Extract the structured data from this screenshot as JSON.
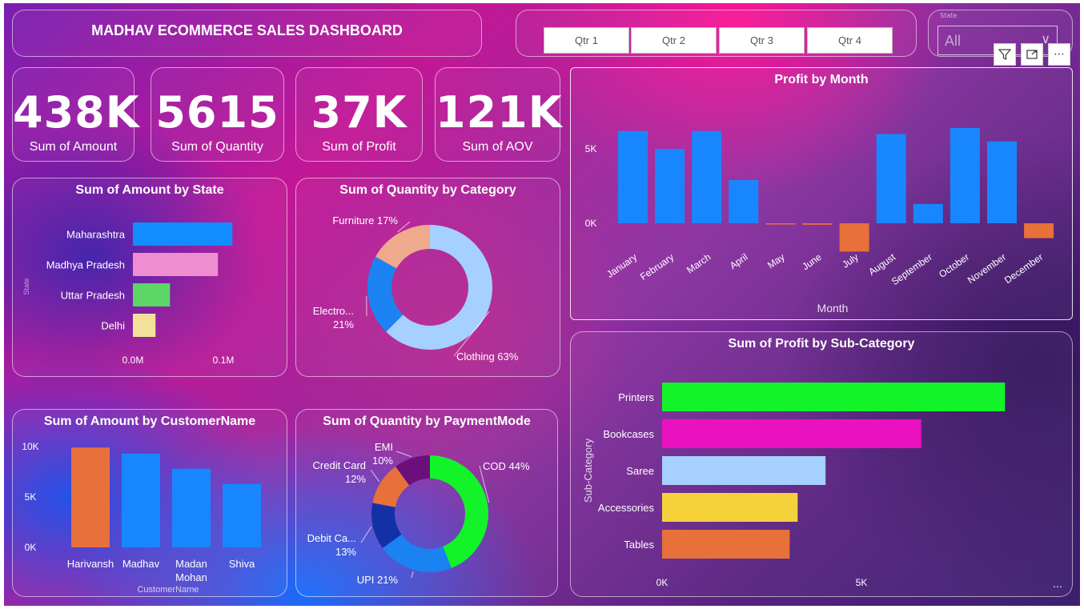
{
  "header": {
    "title": "MADHAV ECOMMERCE SALES DASHBOARD"
  },
  "quarters": [
    "Qtr 1",
    "Qtr 2",
    "Qtr 3",
    "Qtr 4"
  ],
  "state_slicer": {
    "label": "State",
    "value": "All"
  },
  "kpis": [
    {
      "value": "438K",
      "label": "Sum of Amount"
    },
    {
      "value": "5615",
      "label": "Sum of Quantity"
    },
    {
      "value": "37K",
      "label": "Sum of Profit"
    },
    {
      "value": "121K",
      "label": "Sum of AOV"
    }
  ],
  "chart_data": [
    {
      "id": "amount_by_state",
      "type": "bar",
      "orientation": "horizontal",
      "title": "Sum of Amount by State",
      "ylabel": "State",
      "categories": [
        "Maharashtra",
        "Madhya Pradesh",
        "Uttar Pradesh",
        "Delhi"
      ],
      "values": [
        0.11,
        0.094,
        0.041,
        0.025
      ],
      "colors": [
        "#118DFF",
        "#EE8DD0",
        "#5BD667",
        "#F3E19A"
      ],
      "xticks": [
        "0.0M",
        "0.1M"
      ],
      "xlim": [
        0,
        0.1
      ]
    },
    {
      "id": "quantity_by_category",
      "type": "pie",
      "donut": true,
      "title": "Sum of Quantity by Category",
      "labels": [
        "Clothing 63%",
        "Electro...\n21%",
        "Furniture 17%"
      ],
      "values": [
        63,
        21,
        17
      ],
      "colors": [
        "#A5D0FF",
        "#1B84F2",
        "#EFA98C"
      ]
    },
    {
      "id": "amount_by_customer",
      "type": "bar",
      "title": "Sum of Amount by CustomerName",
      "xlabel": "CustomerName",
      "categories": [
        "Harivansh",
        "Madhav",
        "Madan Mohan",
        "Shiva"
      ],
      "values": [
        9900,
        9300,
        7800,
        6300
      ],
      "colors": [
        "#E8703A",
        "#1887FF",
        "#1887FF",
        "#1887FF"
      ],
      "yticks": [
        "0K",
        "5K",
        "10K"
      ],
      "ylim": [
        0,
        10000
      ]
    },
    {
      "id": "quantity_by_payment",
      "type": "pie",
      "donut": true,
      "title": "Sum of Quantity by PaymentMode",
      "labels": [
        "COD 44%",
        "UPI 21%",
        "Debit Ca...\n13%",
        "Credit Card\n12%",
        "EMI\n10%"
      ],
      "values": [
        44,
        21,
        13,
        12,
        10
      ],
      "colors": [
        "#12F32A",
        "#1A82F1",
        "#1231A6",
        "#E8703A",
        "#6B0F7A"
      ]
    },
    {
      "id": "profit_by_month",
      "type": "bar",
      "title": "Profit by Month",
      "xlabel": "Month",
      "categories": [
        "January",
        "February",
        "March",
        "April",
        "May",
        "June",
        "July",
        "August",
        "September",
        "October",
        "November",
        "December"
      ],
      "values": [
        6200,
        5000,
        6200,
        2900,
        -50,
        -100,
        -1900,
        6000,
        1300,
        6400,
        5500,
        -1000
      ],
      "positive_color": "#1887FF",
      "negative_color": "#E8703A",
      "yticks": [
        "0K",
        "5K"
      ],
      "ylim": [
        -2000,
        7000
      ]
    },
    {
      "id": "profit_by_subcategory",
      "type": "bar",
      "orientation": "horizontal",
      "title": "Sum of Profit by Sub-Category",
      "ylabel": "Sub-Category",
      "categories": [
        "Printers",
        "Bookcases",
        "Saree",
        "Accessories",
        "Tables"
      ],
      "values": [
        8600,
        6500,
        4100,
        3400,
        3200
      ],
      "colors": [
        "#12F32A",
        "#EA12C0",
        "#A5D0FF",
        "#F6D23A",
        "#E8703A"
      ],
      "xticks": [
        "0K",
        "5K"
      ],
      "xlim": [
        0,
        5000
      ]
    }
  ]
}
